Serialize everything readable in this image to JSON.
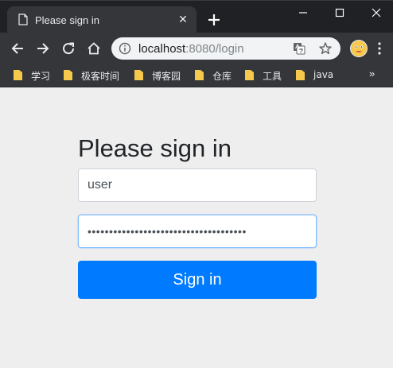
{
  "browser": {
    "tab": {
      "title": "Please sign in",
      "close_glyph": "✕"
    },
    "omnibox": {
      "url_host": "localhost",
      "url_rest": ":8080/login"
    },
    "bookmarks": [
      {
        "label": "学习"
      },
      {
        "label": "极客时间"
      },
      {
        "label": "博客园"
      },
      {
        "label": "仓库"
      },
      {
        "label": "工具"
      },
      {
        "label": "java"
      }
    ],
    "bookmarks_more": "»"
  },
  "form": {
    "heading": "Please sign in",
    "username_value": "user",
    "password_mask": "•••••••••••••••••••••••••••••••••••••",
    "submit_label": "Sign in"
  },
  "colors": {
    "primary": "#007bff",
    "chrome_dark": "#202124",
    "chrome_toolbar": "#35363a",
    "page_bg": "#eeeeee",
    "focus_border": "#80bdff"
  },
  "icons": [
    "page-icon",
    "close-icon",
    "plus-icon",
    "minimize-icon",
    "maximize-icon",
    "window-close-icon",
    "back-arrow-icon",
    "forward-arrow-icon",
    "reload-icon",
    "home-icon",
    "info-icon",
    "translate-icon",
    "star-icon",
    "avatar",
    "menu-icon",
    "folder-icon"
  ]
}
